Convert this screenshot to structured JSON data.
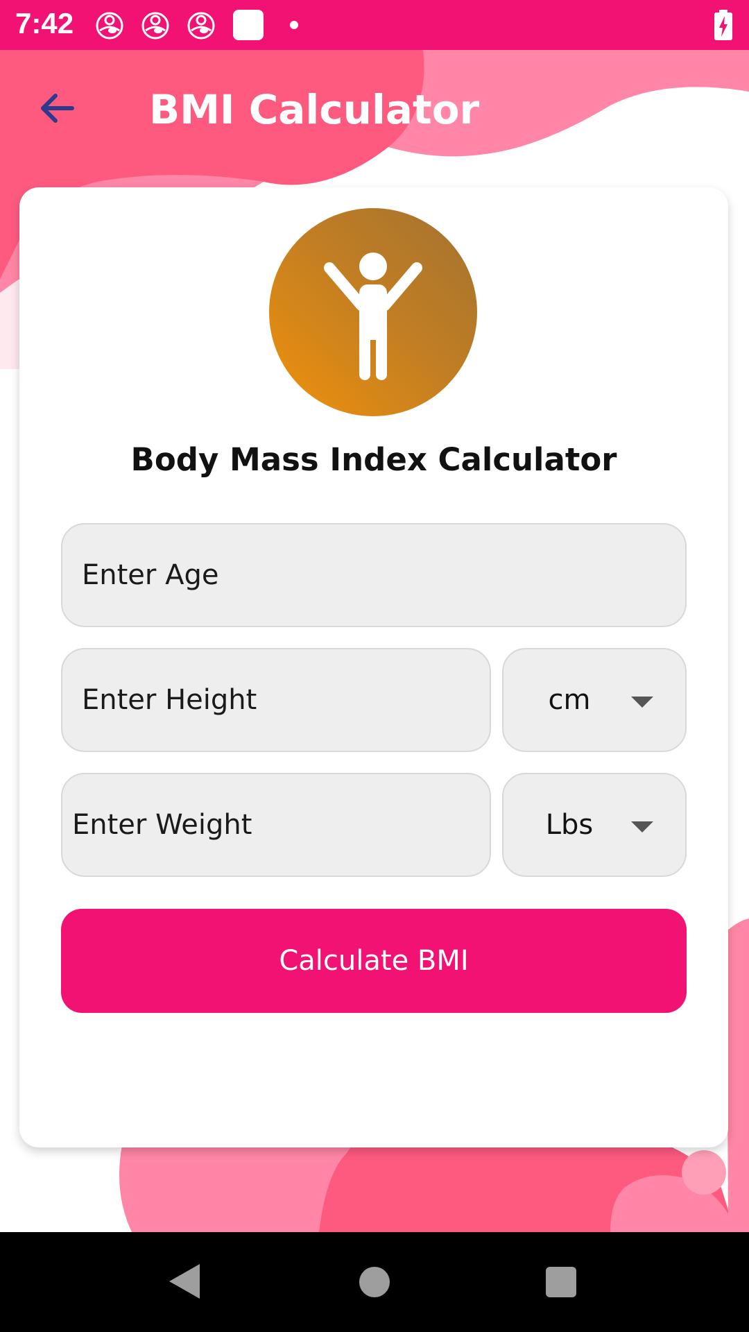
{
  "status_bar": {
    "time": "7:42",
    "notification_icons": [
      "app-notification-icon",
      "app-notification-icon",
      "app-notification-icon"
    ]
  },
  "app_bar": {
    "title": "BMI Calculator",
    "back_icon": "arrow-left-icon"
  },
  "card": {
    "avatar_icon": "person-arms-raised-icon",
    "title": "Body Mass Index Calculator",
    "age": {
      "placeholder": "Enter Age",
      "value": ""
    },
    "height": {
      "placeholder": "Enter Height",
      "value": "",
      "unit": "cm"
    },
    "weight": {
      "placeholder": "Enter Weight",
      "value": "",
      "unit": "Lbs"
    },
    "calculate_label": "Calculate BMI"
  },
  "colors": {
    "primary": "#f21273",
    "blob_dark": "#fe5a80",
    "blob_light": "#ff86a6",
    "avatar_gradient_start": "#a37330",
    "avatar_gradient_end": "#f0920a",
    "back_arrow": "#2e3a8c"
  },
  "nav_bar": {
    "icons": [
      "nav-back-icon",
      "nav-home-icon",
      "nav-recents-icon"
    ]
  }
}
